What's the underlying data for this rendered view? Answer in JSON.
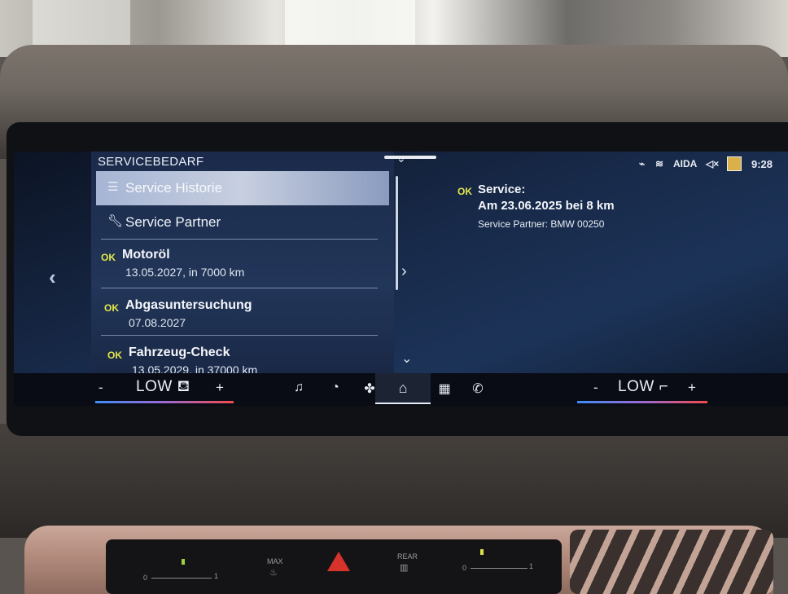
{
  "left_panel": {
    "title": "SERVICEBEDARF",
    "items": [
      {
        "label": "Service Historie",
        "icon": "list-icon",
        "selected": true
      },
      {
        "label": "Service Partner",
        "icon": "wrench-icon",
        "selected": false
      }
    ],
    "services": [
      {
        "status": "OK",
        "name": "Motoröl",
        "detail": "13.05.2027, in 7000 km"
      },
      {
        "status": "OK",
        "name": "Abgasuntersuchung",
        "detail": "07.08.2027"
      },
      {
        "status": "OK",
        "name": "Fahrzeug-Check",
        "detail": "13.05.2029, in 37000 km"
      }
    ]
  },
  "right_panel": {
    "status": "OK",
    "title": "Service:",
    "date_line": "Am 23.06.2025 bei 8 km",
    "partner_line": "Service Partner: BMW 00250"
  },
  "status_bar": {
    "network": "AIDA",
    "time": "9:28",
    "icons": [
      "phone-signal-icon",
      "seat-heat-icon",
      "mute-icon",
      "message-icon"
    ]
  },
  "climate": {
    "left": {
      "minus": "-",
      "value": "LOW",
      "plus": "+"
    },
    "right": {
      "minus": "-",
      "value": "LOW",
      "plus": "+"
    }
  },
  "nav": [
    "music-icon",
    "gauge-icon",
    "fan-icon",
    "home-icon",
    "apps-icon",
    "phone-icon"
  ],
  "control_panel": {
    "max_label": "MAX",
    "rear_label": "REAR",
    "scale_left_start": "0",
    "scale_left_end": "1",
    "scale_right_start": "0",
    "scale_right_end": "1"
  },
  "colors": {
    "ok": "#e3e84a",
    "accent_blue": "#3d8bf5",
    "accent_red": "#f24a4a"
  }
}
